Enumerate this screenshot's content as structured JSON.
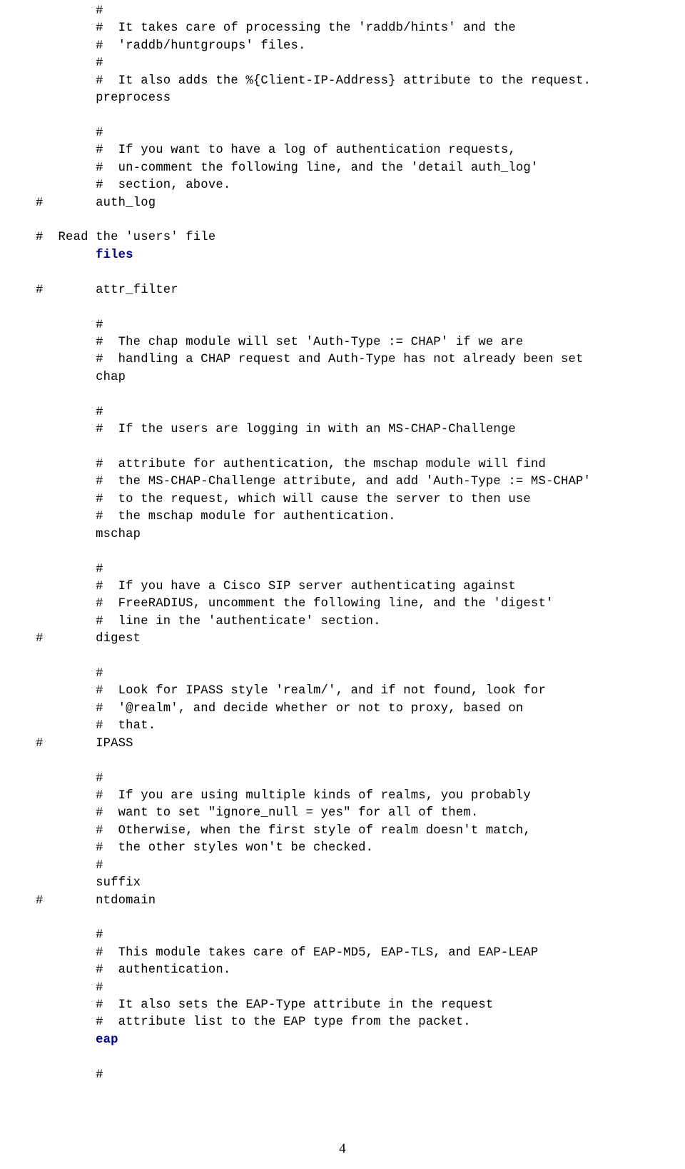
{
  "lines": [
    {
      "i": "        ",
      "t": "#"
    },
    {
      "i": "        ",
      "t": "#  It takes care of processing the 'raddb/hints' and the"
    },
    {
      "i": "        ",
      "t": "#  'raddb/huntgroups' files."
    },
    {
      "i": "        ",
      "t": "#"
    },
    {
      "i": "        ",
      "t": "#  It also adds the %{Client-IP-Address} attribute to the request."
    },
    {
      "i": "        ",
      "t": "preprocess"
    },
    {
      "i": "        ",
      "t": ""
    },
    {
      "i": "        ",
      "t": "#"
    },
    {
      "i": "        ",
      "t": "#  If you want to have a log of authentication requests,"
    },
    {
      "i": "        ",
      "t": "#  un-comment the following line, and the 'detail auth_log'"
    },
    {
      "i": "        ",
      "t": "#  section, above."
    },
    {
      "i": "",
      "t": "#       auth_log"
    },
    {
      "i": "",
      "t": ""
    },
    {
      "i": "",
      "t": "#  Read the 'users' file"
    },
    {
      "i": "        ",
      "t": "files",
      "bold": true
    },
    {
      "i": "",
      "t": ""
    },
    {
      "i": "",
      "t": "#       attr_filter"
    },
    {
      "i": "",
      "t": ""
    },
    {
      "i": "        ",
      "t": "#"
    },
    {
      "i": "        ",
      "t": "#  The chap module will set 'Auth-Type := CHAP' if we are"
    },
    {
      "i": "        ",
      "t": "#  handling a CHAP request and Auth-Type has not already been set"
    },
    {
      "i": "        ",
      "t": "chap"
    },
    {
      "i": "",
      "t": ""
    },
    {
      "i": "        ",
      "t": "#"
    },
    {
      "i": "        ",
      "t": "#  If the users are logging in with an MS-CHAP-Challenge"
    },
    {
      "i": "",
      "t": ""
    },
    {
      "i": "        ",
      "t": "#  attribute for authentication, the mschap module will find"
    },
    {
      "i": "        ",
      "t": "#  the MS-CHAP-Challenge attribute, and add 'Auth-Type := MS-CHAP'"
    },
    {
      "i": "        ",
      "t": "#  to the request, which will cause the server to then use"
    },
    {
      "i": "        ",
      "t": "#  the mschap module for authentication."
    },
    {
      "i": "        ",
      "t": "mschap"
    },
    {
      "i": "",
      "t": ""
    },
    {
      "i": "        ",
      "t": "#"
    },
    {
      "i": "        ",
      "t": "#  If you have a Cisco SIP server authenticating against"
    },
    {
      "i": "        ",
      "t": "#  FreeRADIUS, uncomment the following line, and the 'digest'"
    },
    {
      "i": "        ",
      "t": "#  line in the 'authenticate' section."
    },
    {
      "i": "",
      "t": "#       digest"
    },
    {
      "i": "",
      "t": ""
    },
    {
      "i": "        ",
      "t": "#"
    },
    {
      "i": "        ",
      "t": "#  Look for IPASS style 'realm/', and if not found, look for"
    },
    {
      "i": "        ",
      "t": "#  '@realm', and decide whether or not to proxy, based on"
    },
    {
      "i": "        ",
      "t": "#  that."
    },
    {
      "i": "",
      "t": "#       IPASS"
    },
    {
      "i": "",
      "t": ""
    },
    {
      "i": "        ",
      "t": "#"
    },
    {
      "i": "        ",
      "t": "#  If you are using multiple kinds of realms, you probably"
    },
    {
      "i": "        ",
      "t": "#  want to set \"ignore_null = yes\" for all of them."
    },
    {
      "i": "        ",
      "t": "#  Otherwise, when the first style of realm doesn't match,"
    },
    {
      "i": "        ",
      "t": "#  the other styles won't be checked."
    },
    {
      "i": "        ",
      "t": "#"
    },
    {
      "i": "        ",
      "t": "suffix"
    },
    {
      "i": "",
      "t": "#       ntdomain"
    },
    {
      "i": "",
      "t": ""
    },
    {
      "i": "        ",
      "t": "#"
    },
    {
      "i": "        ",
      "t": "#  This module takes care of EAP-MD5, EAP-TLS, and EAP-LEAP"
    },
    {
      "i": "        ",
      "t": "#  authentication."
    },
    {
      "i": "        ",
      "t": "#"
    },
    {
      "i": "        ",
      "t": "#  It also sets the EAP-Type attribute in the request"
    },
    {
      "i": "        ",
      "t": "#  attribute list to the EAP type from the packet."
    },
    {
      "i": "        ",
      "t": "eap",
      "bold": true
    },
    {
      "i": "",
      "t": ""
    },
    {
      "i": "        ",
      "t": "#"
    }
  ],
  "page_number": "4"
}
